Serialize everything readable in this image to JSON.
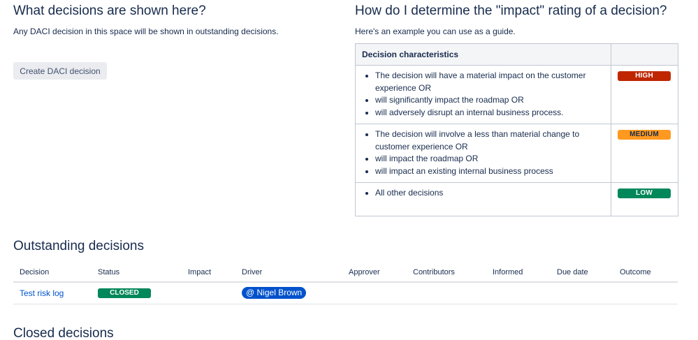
{
  "left": {
    "title": "What decisions are shown here?",
    "description": "Any DACI decision in this space will be shown in outstanding decisions.",
    "create_button": "Create DACI decision"
  },
  "right": {
    "title": "How do I determine the \"impact\" rating of a decision?",
    "description": "Here's an example you can use as a guide.",
    "table": {
      "header": "Decision characteristics",
      "rows": [
        {
          "items": [
            "The decision will have a material impact on the customer experience OR",
            "will significantly impact the roadmap OR",
            "will adversely disrupt an internal business process."
          ],
          "rating": "HIGH",
          "color": "#bf2600"
        },
        {
          "items": [
            "The decision will involve a less than material change to customer experience OR",
            "will impact the roadmap OR",
            "will impact an existing internal business process"
          ],
          "rating": "MEDIUM",
          "color": "#ff991f"
        },
        {
          "items": [
            "All other decisions"
          ],
          "rating": "LOW",
          "color": "#00875a"
        }
      ]
    }
  },
  "outstanding": {
    "title": "Outstanding decisions",
    "columns": [
      "Decision",
      "Status",
      "Impact",
      "Driver",
      "Approver",
      "Contributors",
      "Informed",
      "Due date",
      "Outcome"
    ],
    "rows": [
      {
        "decision": "Test risk log",
        "status": "CLOSED",
        "impact": "",
        "driver": "@ Nigel Brown",
        "approver": "",
        "contributors": "",
        "informed": "",
        "due_date": "",
        "outcome": ""
      }
    ]
  },
  "closed": {
    "title": "Closed decisions"
  }
}
